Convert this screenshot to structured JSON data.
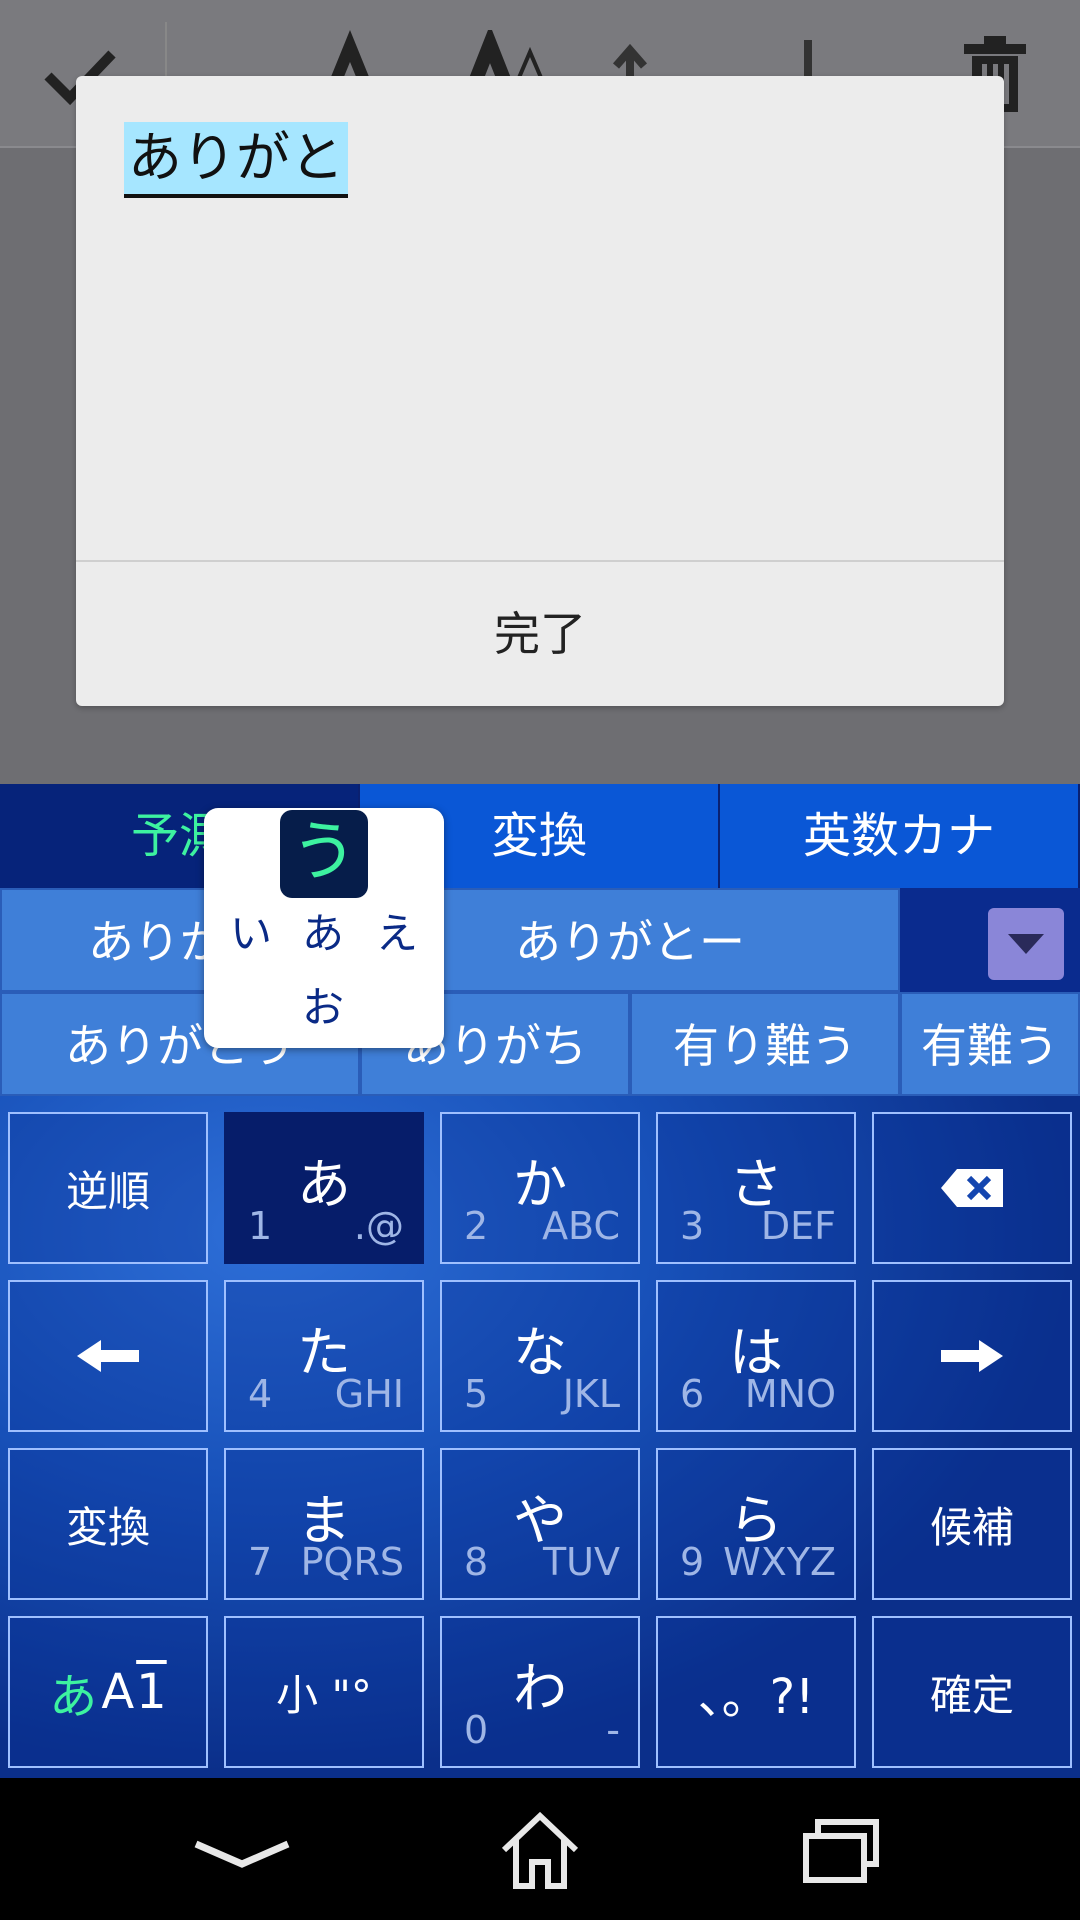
{
  "dialog": {
    "text": "ありがと",
    "done_label": "完了"
  },
  "keyboard": {
    "modes": [
      "予測",
      "変換",
      "英数カナ"
    ],
    "candidates_row1": [
      "ありがと",
      "ありがとー"
    ],
    "candidates_row2": [
      "ありがとう",
      "ありがち",
      "有り難う",
      "有難う"
    ],
    "keys": {
      "reverse": "逆順",
      "a": {
        "main": "あ",
        "num": "1",
        "alt": ".@"
      },
      "ka": {
        "main": "か",
        "num": "2",
        "alt": "ABC"
      },
      "sa": {
        "main": "さ",
        "num": "3",
        "alt": "DEF"
      },
      "ta": {
        "main": "た",
        "num": "4",
        "alt": "GHI"
      },
      "na": {
        "main": "な",
        "num": "5",
        "alt": "JKL"
      },
      "ha": {
        "main": "は",
        "num": "6",
        "alt": "MNO"
      },
      "convert": "変換",
      "ma": {
        "main": "ま",
        "num": "7",
        "alt": "PQRS"
      },
      "ya": {
        "main": "や",
        "num": "8",
        "alt": "TUV"
      },
      "ra": {
        "main": "ら",
        "num": "9",
        "alt": "WXYZ"
      },
      "candidate": "候補",
      "small": "小 \"°",
      "wa": {
        "main": "わ",
        "num": "0",
        "alt": "-"
      },
      "punct": "、。?!",
      "confirm": "確定"
    },
    "input_mode": {
      "kana": "あ",
      "alpha": "A",
      "num": "1"
    },
    "flick_popup": {
      "center": "う",
      "left": "い",
      "middle": "あ",
      "right": "え",
      "bottom": "お"
    }
  },
  "colors": {
    "accent_green": "#3df2a0",
    "keyboard_blue": "#0b2f8a"
  }
}
